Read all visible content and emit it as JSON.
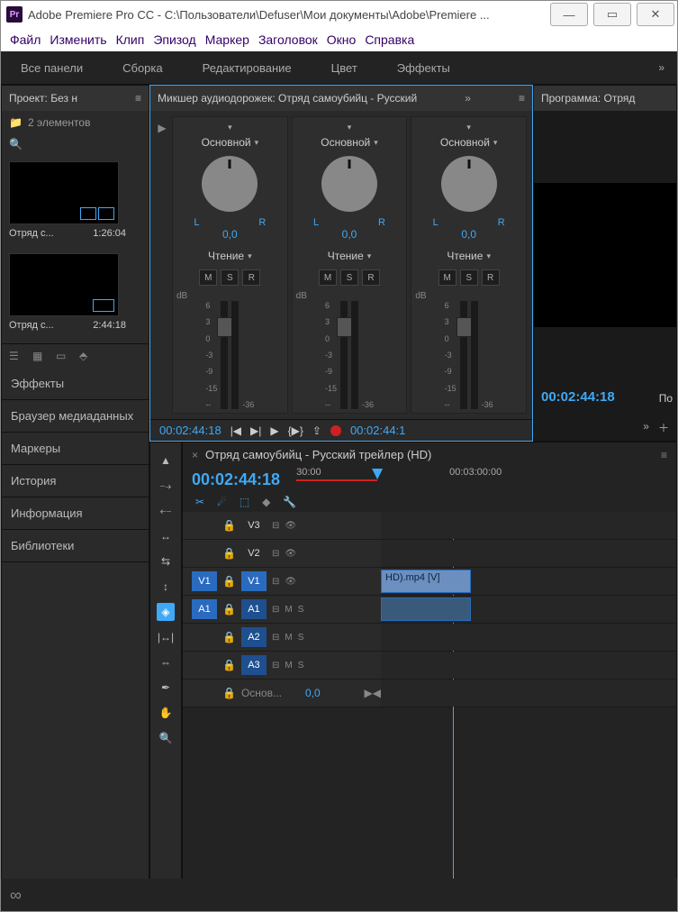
{
  "window": {
    "title": "Adobe Premiere Pro CC - C:\\Пользователи\\Defuser\\Мои документы\\Adobe\\Premiere ..."
  },
  "menu": [
    "Файл",
    "Изменить",
    "Клип",
    "Эпизод",
    "Маркер",
    "Заголовок",
    "Окно",
    "Справка"
  ],
  "workspaces": [
    "Все панели",
    "Сборка",
    "Редактирование",
    "Цвет",
    "Эффекты"
  ],
  "project": {
    "title": "Проект: Без н",
    "elements": "2 элементов",
    "items": [
      {
        "name": "Отряд с...",
        "duration": "1:26:04"
      },
      {
        "name": "Отряд с...",
        "duration": "2:44:18"
      }
    ]
  },
  "side_panels": [
    "Эффекты",
    "Браузер медиаданных",
    "Маркеры",
    "История",
    "Информация",
    "Библиотеки"
  ],
  "mixer": {
    "title": "Микшер аудиодорожек: Отряд самоубийц - Русский",
    "channel_main": "Основной",
    "mode": "Чтение",
    "L": "L",
    "R": "R",
    "pan_value": "0,0",
    "msr": {
      "m": "M",
      "s": "S",
      "r": "R"
    },
    "db_label": "dB",
    "db_ticks": [
      "6",
      "3",
      "0",
      "-3",
      "-9",
      "-15",
      "--"
    ],
    "db_right": "-36",
    "tc_left": "00:02:44:18",
    "tc_right": "00:02:44:1"
  },
  "program": {
    "title": "Программа: Отряд",
    "tc": "00:02:44:18",
    "po": "По"
  },
  "timeline": {
    "title": "Отряд самоубийц - Русский трейлер (HD)",
    "tc": "00:02:44:18",
    "ruler": {
      "label1": "30:00",
      "label2": "00:03:00:00"
    },
    "tracks": {
      "v3": "V3",
      "v2": "V2",
      "v1": "V1",
      "a1": "A1",
      "a2": "A2",
      "a3": "A3",
      "m": "M",
      "s": "S"
    },
    "clip_label": "HD).mp4 [V]",
    "master": {
      "label": "Основ...",
      "value": "0,0"
    }
  }
}
